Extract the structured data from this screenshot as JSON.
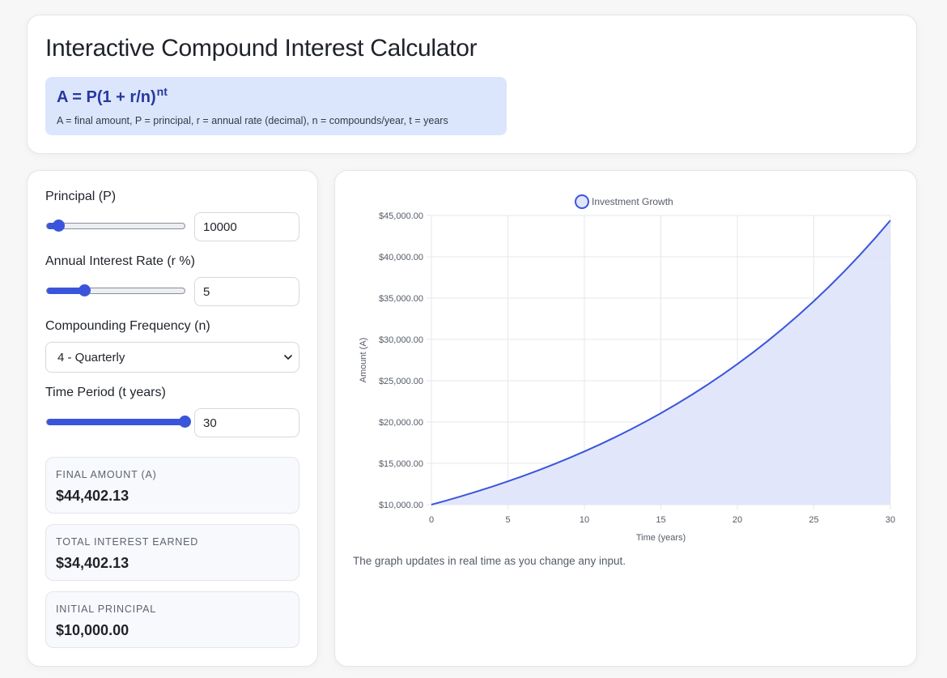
{
  "header": {
    "title": "Interactive Compound Interest Calculator",
    "formula": "A = P(1 + r/n)",
    "formula_exponent": "nt",
    "formula_legend": "A = final amount, P = principal, r = annual rate (decimal), n = compounds/year, t = years"
  },
  "controls": {
    "principal": {
      "label": "Principal (P)",
      "value": "10000",
      "slider_fraction": 0.08
    },
    "rate": {
      "label": "Annual Interest Rate (r %)",
      "value": "5",
      "slider_fraction": 0.27
    },
    "frequency": {
      "label": "Compounding Frequency (n)",
      "selected": "4 - Quarterly"
    },
    "time": {
      "label": "Time Period (t years)",
      "value": "30",
      "slider_fraction": 1.0
    }
  },
  "results": {
    "final": {
      "label": "FINAL AMOUNT (A)",
      "value": "$44,402.13"
    },
    "interest": {
      "label": "TOTAL INTEREST EARNED",
      "value": "$34,402.13"
    },
    "principal": {
      "label": "INITIAL PRINCIPAL",
      "value": "$10,000.00"
    }
  },
  "chart_note": "The graph updates in real time as you change any input.",
  "colors": {
    "accent": "#3a55db",
    "line": "#3a55db",
    "fill": "#dfe5fb",
    "formula_bg": "#dbe6fd"
  },
  "chart_data": {
    "type": "area",
    "legend": "Investment Growth",
    "legend_position": "top-center",
    "xlabel": "Time (years)",
    "ylabel": "Amount (A)",
    "xlim": [
      0,
      30
    ],
    "ylim": [
      10000,
      45000
    ],
    "x_ticks": [
      "0",
      "5",
      "10",
      "15",
      "20",
      "25",
      "30"
    ],
    "x_tick_values": [
      0,
      5,
      10,
      15,
      20,
      25,
      30
    ],
    "y_ticks": [
      "$10,000.00",
      "$15,000.00",
      "$20,000.00",
      "$25,000.00",
      "$30,000.00",
      "$35,000.00",
      "$40,000.00",
      "$45,000.00"
    ],
    "y_tick_values": [
      10000,
      15000,
      20000,
      25000,
      30000,
      35000,
      40000,
      45000
    ],
    "grid": true,
    "series": [
      {
        "name": "Investment Growth",
        "x": [
          0,
          1,
          2,
          3,
          4,
          5,
          6,
          7,
          8,
          9,
          10,
          11,
          12,
          13,
          14,
          15,
          16,
          17,
          18,
          19,
          20,
          21,
          22,
          23,
          24,
          25,
          26,
          27,
          28,
          29,
          30
        ],
        "y": [
          10000,
          10509.45,
          11044.86,
          11607.55,
          12198.9,
          12820.37,
          13473.51,
          14159.92,
          14881.31,
          15639.45,
          16436.19,
          17273.54,
          18153.55,
          19078.39,
          20050.36,
          21071.81,
          22145.3,
          23273.49,
          24459.16,
          25705.24,
          27014.8,
          28391.08,
          29837.47,
          31357.54,
          32955.05,
          34633.95,
          36398.38,
          38252.71,
          40201.51,
          42249.6,
          44402.13
        ]
      }
    ]
  }
}
